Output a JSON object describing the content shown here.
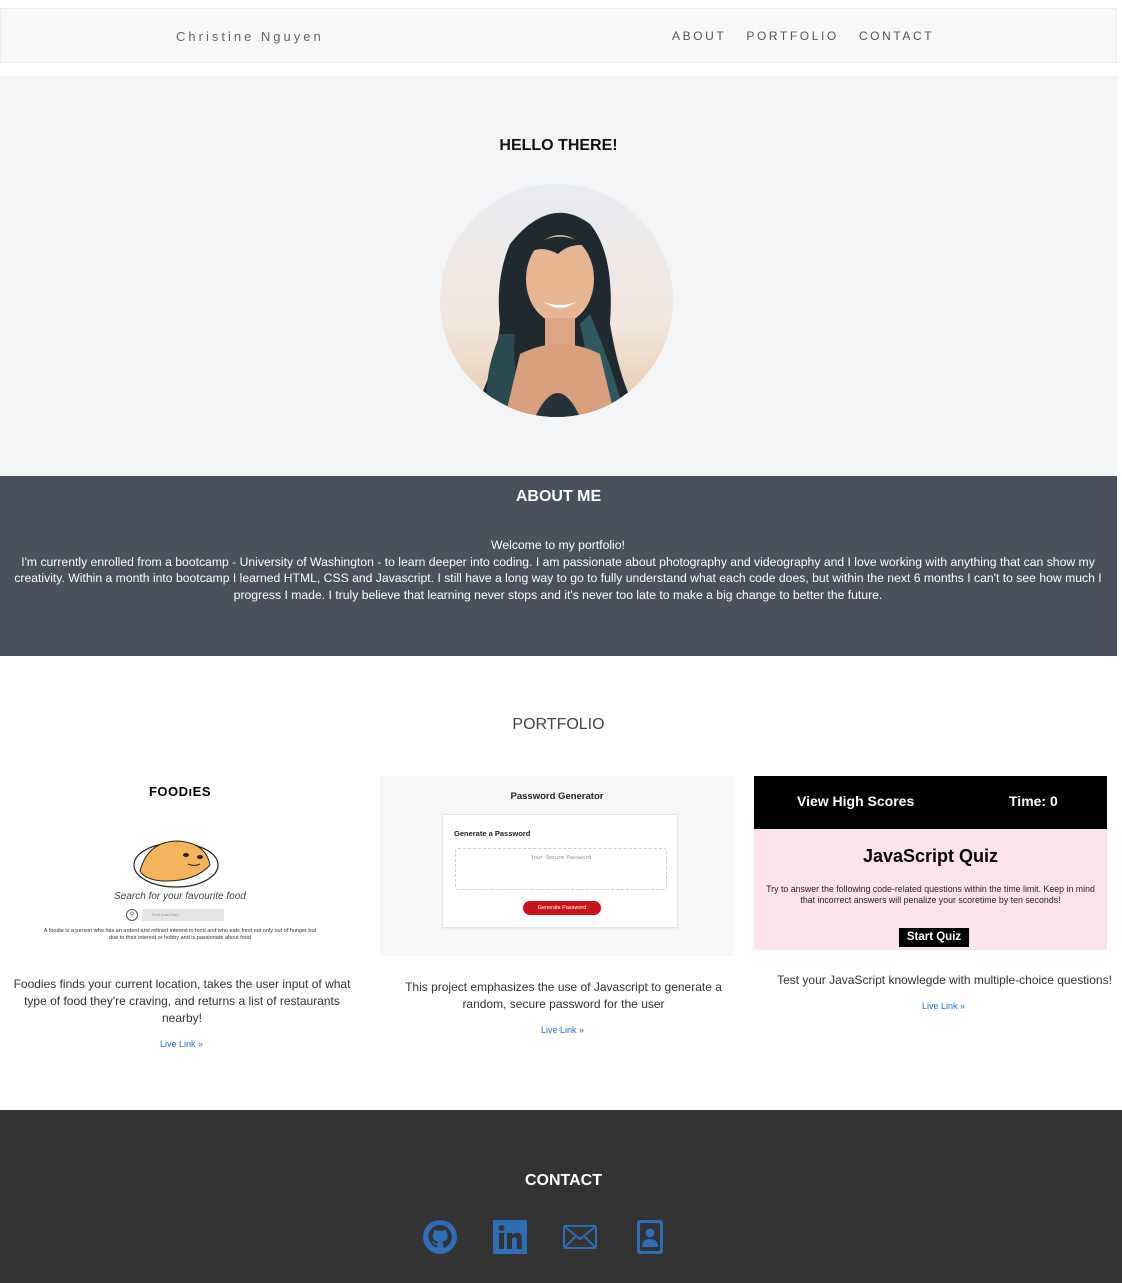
{
  "nav": {
    "brand": "Christine Nguyen",
    "links": [
      "ABOUT",
      "PORTFOLIO",
      "CONTACT"
    ]
  },
  "hero": {
    "title": "HELLO THERE!"
  },
  "about": {
    "title": "ABOUT ME",
    "welcome": "Welcome to my portfolio!",
    "body": "I'm currently enrolled from a bootcamp - University of Washington - to learn deeper into coding. I am passionate about photography and videography and I love working with anything that can show my creativity. Within a month into bootcamp I learned HTML, CSS and Javascript. I still have a long way to go to fully understand what each code does, but within the next 6 months I can't to see how much I progress I made. I truly believe that learning never stops and it's never too late to make a big change to better the future."
  },
  "portfolio": {
    "title": "PORTFOLIO",
    "projects": [
      {
        "description": "Foodies finds your current location, takes the user input of what type of food they're craving, and returns a list of restaurants nearby!",
        "link_label": "Live Link »",
        "thumb": {
          "logo": "FOODıES",
          "tagline": "Search for your favourite food",
          "search_placeholder": "Food (sushi,Bao)",
          "paragraph": "A foodie is a person who has an ardent and refined interest in food and who eats food not only out of hunger but due to their interest or hobby and is passionate about food"
        }
      },
      {
        "description": "This project emphasizes the use of Javascript to generate a random, secure password for the user",
        "link_label": "Live Link »",
        "thumb": {
          "title": "Password Generator",
          "label": "Generate a Password",
          "placeholder": "Your Secure Password",
          "button": "Generate Password"
        }
      },
      {
        "description": "Test your JavaScript knowlegde with multiple-choice questions!",
        "link_label": "Live Link »",
        "thumb": {
          "scores": "View High Scores",
          "time": "Time: 0",
          "title": "JavaScript Quiz",
          "text": "Try to answer the following code-related questions within the time limit. Keep in mind that incorrect answers will penalize your scoretime by ten seconds!",
          "button": "Start Quiz"
        }
      }
    ]
  },
  "footer": {
    "title": "CONTACT",
    "icons": [
      "github-icon",
      "linkedin-icon",
      "email-icon",
      "contact-card-icon"
    ],
    "icon_color": "#2f6db5"
  },
  "colors": {
    "about_bg": "#4a505d",
    "footer_bg": "#333333",
    "link": "#2a6fcf"
  }
}
